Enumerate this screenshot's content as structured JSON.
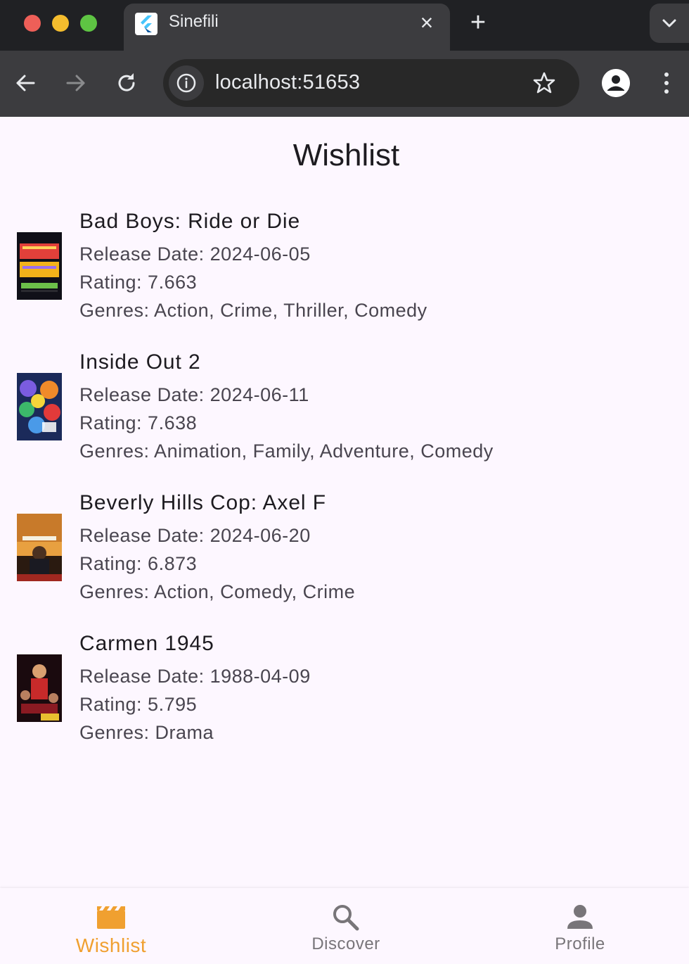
{
  "browser": {
    "tab_title": "Sinefili",
    "url": "localhost:51653"
  },
  "page": {
    "title": "Wishlist"
  },
  "movies": [
    {
      "title": "Bad Boys: Ride or Die",
      "release": "Release Date: 2024-06-05",
      "rating": "Rating: 7.663",
      "genres": "Genres: Action, Crime, Thriller, Comedy"
    },
    {
      "title": "Inside Out 2",
      "release": "Release Date: 2024-06-11",
      "rating": "Rating: 7.638",
      "genres": "Genres: Animation, Family, Adventure, Comedy"
    },
    {
      "title": "Beverly Hills Cop: Axel F",
      "release": "Release Date: 2024-06-20",
      "rating": "Rating: 6.873",
      "genres": "Genres: Action, Comedy, Crime"
    },
    {
      "title": "Carmen 1945",
      "release": "Release Date: 1988-04-09",
      "rating": "Rating: 5.795",
      "genres": "Genres: Drama"
    }
  ],
  "bottom_nav": [
    {
      "label": "Wishlist",
      "icon": "movie-clapper-icon",
      "active": true
    },
    {
      "label": "Discover",
      "icon": "search-icon",
      "active": false
    },
    {
      "label": "Profile",
      "icon": "person-icon",
      "active": false
    }
  ],
  "colors": {
    "accent": "#f0a030",
    "background": "#fdf7ff",
    "title_text": "#1d1b20",
    "secondary_text": "#49454f"
  }
}
